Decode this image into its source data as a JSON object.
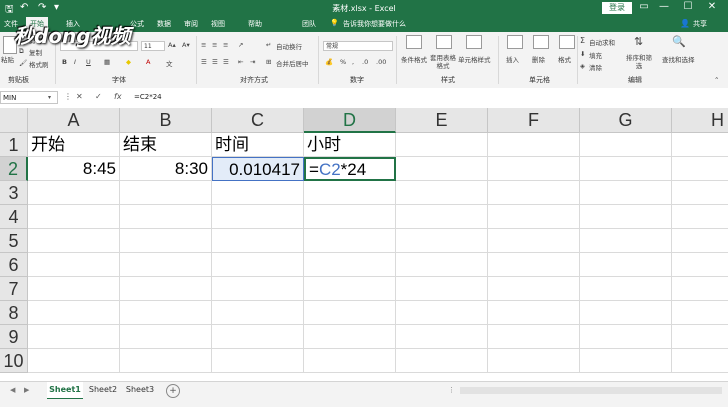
{
  "titlebar": {
    "title": "素材.xlsx - Excel",
    "login": "登录",
    "share": "共享",
    "buttons": [
      "—",
      "☐",
      "✕"
    ],
    "qa_icons": [
      "save-icon",
      "undo-icon",
      "redo-icon"
    ]
  },
  "tabs": [
    {
      "label": "文件"
    },
    {
      "label": "开始"
    },
    {
      "label": "插入"
    },
    {
      "label": "公式"
    },
    {
      "label": "数据"
    },
    {
      "label": "审阅"
    },
    {
      "label": "视图"
    },
    {
      "label": "帮助"
    },
    {
      "label": "团队"
    }
  ],
  "tell_me": "告诉我你想要做什么",
  "ribbon": {
    "paste": "粘贴",
    "cut": "剪切",
    "copy": "复制",
    "format_painter": "格式刷",
    "font_size": "11",
    "wrap_text": "自动换行",
    "merge_center": "合并后居中",
    "number_format": "常规",
    "conditional_format": "条件格式",
    "table_format": "套用表格格式",
    "cell_styles": "单元格样式",
    "insert": "插入",
    "delete": "删除",
    "format": "格式",
    "autosum": "自动求和",
    "fill": "填充",
    "clear": "清除",
    "sort_filter": "排序和筛选",
    "find_select": "查找和选择",
    "groups": [
      "剪贴板",
      "字体",
      "对齐方式",
      "数字",
      "样式",
      "单元格",
      "编辑"
    ]
  },
  "formula_bar": {
    "name_box": "MIN",
    "cancel": "✕",
    "enter": "✓",
    "fx": "fx",
    "formula": "=C2*24"
  },
  "columns": [
    "A",
    "B",
    "C",
    "D",
    "E",
    "F",
    "G",
    "H"
  ],
  "rows": [
    "1",
    "2",
    "3",
    "4",
    "5",
    "6",
    "7",
    "8",
    "9",
    "10"
  ],
  "cells": {
    "A1": "开始",
    "B1": "结束",
    "C1": "时间",
    "D1": "小时",
    "A2": "8:45",
    "B2": "8:30",
    "C2": "0.010417",
    "D2_eq": "=",
    "D2_ref": "C2",
    "D2_rest": "*24"
  },
  "sheets": [
    {
      "label": "Sheet1",
      "active": true
    },
    {
      "label": "Sheet2",
      "active": false
    },
    {
      "label": "Sheet3",
      "active": false
    }
  ],
  "add_sheet": "+",
  "watermark": "秒dong视频",
  "colors": {
    "excel_green": "#217346",
    "reference_blue": "#4472c4"
  }
}
